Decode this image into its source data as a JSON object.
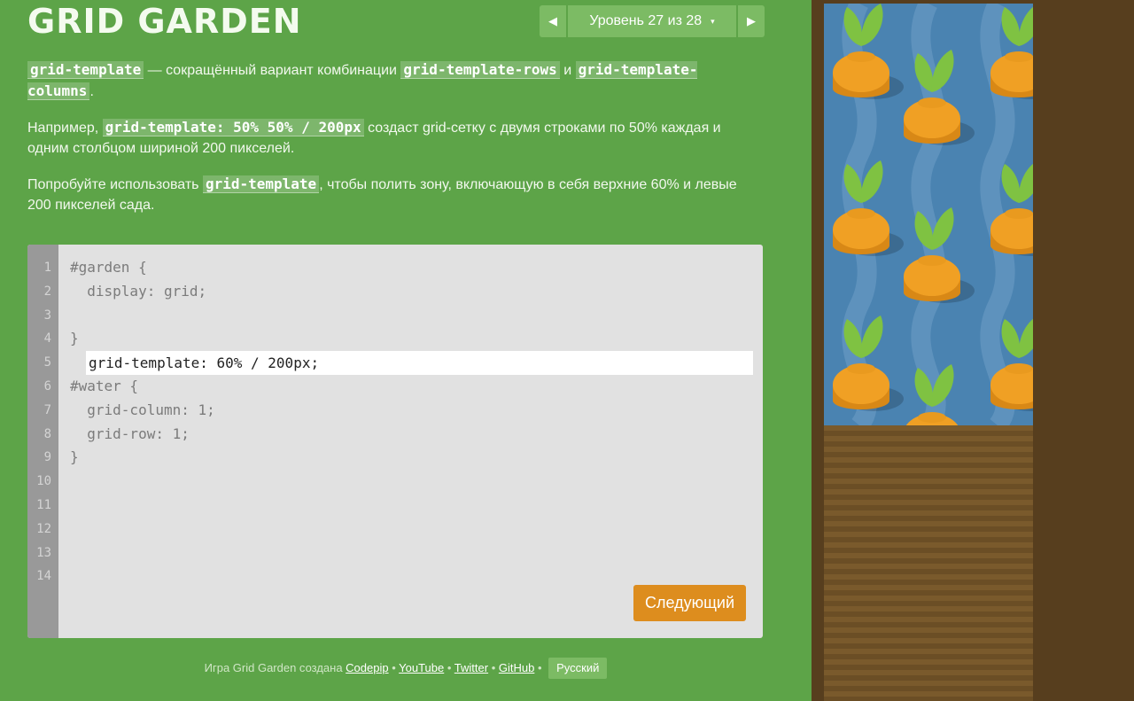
{
  "title": "GRID GARDEN",
  "level_nav": {
    "prev_label": "◀",
    "next_label": "▶",
    "level_label": "Уровень 27 из 28",
    "caret": "▾"
  },
  "instructions": {
    "p1": {
      "code1": "grid-template",
      "text1": " — сокращённый вариант комбинации ",
      "code2": "grid-template-rows",
      "text2": " и ",
      "code3": "grid-template-columns",
      "text3": "."
    },
    "p2": {
      "text1": "Например, ",
      "code1": "grid-template: 50% 50% / 200px",
      "text2": " создаст grid-сетку с двумя строками по 50% каждая и одним столбцом шириной 200 пикселей."
    },
    "p3": {
      "text1": "Попробуйте использовать ",
      "code1": "grid-template",
      "text2": ", чтобы полить зону, включающую в себя верхние 60% и левые 200 пикселей сада."
    }
  },
  "editor": {
    "line_numbers": [
      "1",
      "2",
      "3",
      "4",
      "5",
      "6",
      "7",
      "8",
      "9",
      "10",
      "11",
      "12",
      "13",
      "14"
    ],
    "line1": "#garden {",
    "line2": "  display: grid;",
    "input_value": "grid-template: 60% / 200px;",
    "line4": "}",
    "line6": "#water {",
    "line7": "  grid-column: 1;",
    "line8": "  grid-row: 1;",
    "line9": "}",
    "next_button": "Следующий"
  },
  "footer": {
    "prefix": "Игра Grid Garden создана ",
    "links": [
      "Codepip",
      "YouTube",
      "Twitter",
      "GitHub"
    ],
    "sep": " • ",
    "language": "Русский"
  },
  "colors": {
    "background": "#5da448",
    "water": "#4a83b1",
    "soil": "#7a5a2c",
    "carrot": "#f0a024",
    "leaf": "#7fc242",
    "button": "#dd8d1e"
  }
}
